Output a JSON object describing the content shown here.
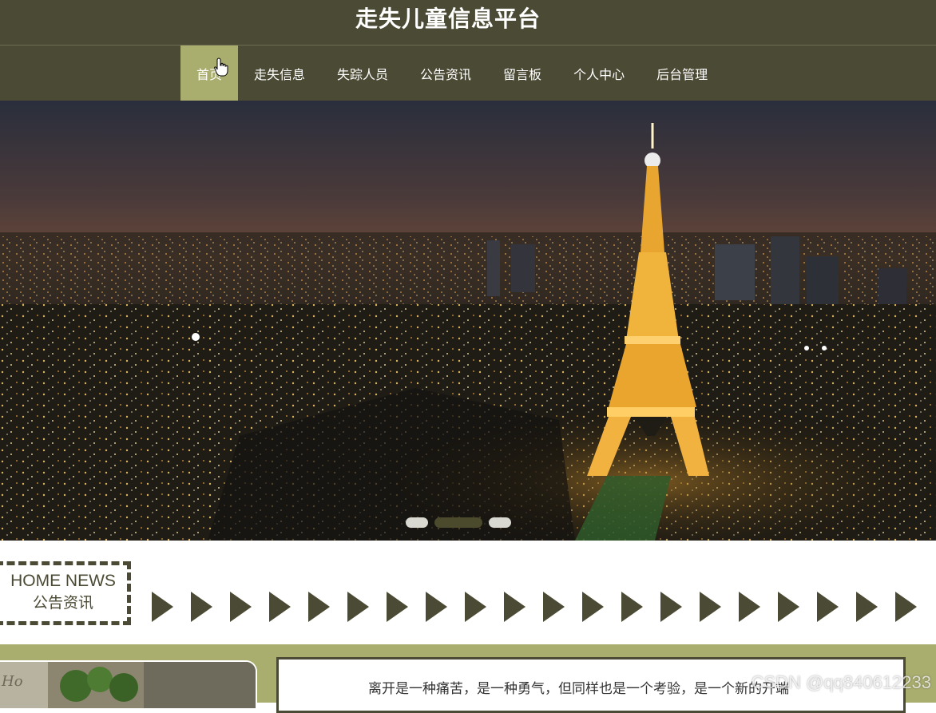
{
  "header": {
    "title": "走失儿童信息平台"
  },
  "nav": {
    "items": [
      {
        "label": "首页",
        "active": true
      },
      {
        "label": "走失信息"
      },
      {
        "label": "失踪人员"
      },
      {
        "label": "公告资讯"
      },
      {
        "label": "留言板"
      },
      {
        "label": "个人中心"
      },
      {
        "label": "后台管理"
      }
    ]
  },
  "banner": {
    "slides": 3,
    "active_slide": 2
  },
  "news": {
    "heading_en": "HOME NEWS",
    "heading_cn": "公告资讯",
    "arrow_count": 20
  },
  "content": {
    "text": "离开是一种痛苦，是一种勇气，但同样也是一个考验，是一个新的开端"
  },
  "watermark": "CSDN @qq840612233",
  "colors": {
    "primary": "#4b4a34",
    "accent": "#a9ad6e",
    "background": "#ffffff"
  }
}
